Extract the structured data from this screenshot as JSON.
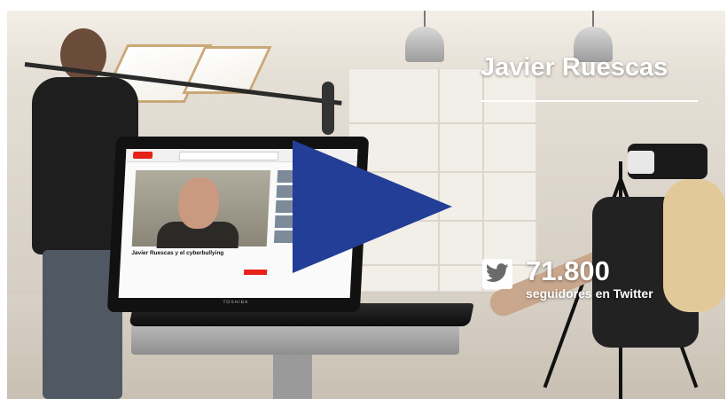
{
  "overlay": {
    "name": "Javier Ruescas",
    "followers_count": "71.800",
    "followers_label": "seguidores en Twitter"
  },
  "laptop_screen": {
    "video_title": "Javier Ruescas y el cyberbullying",
    "brand": "TOSHIBA"
  },
  "icons": {
    "play": "play-icon",
    "twitter": "twitter-bird-icon"
  },
  "colors": {
    "play_button": "#233e96",
    "overlay_text": "#ffffff",
    "youtube_red": "#e62117"
  }
}
